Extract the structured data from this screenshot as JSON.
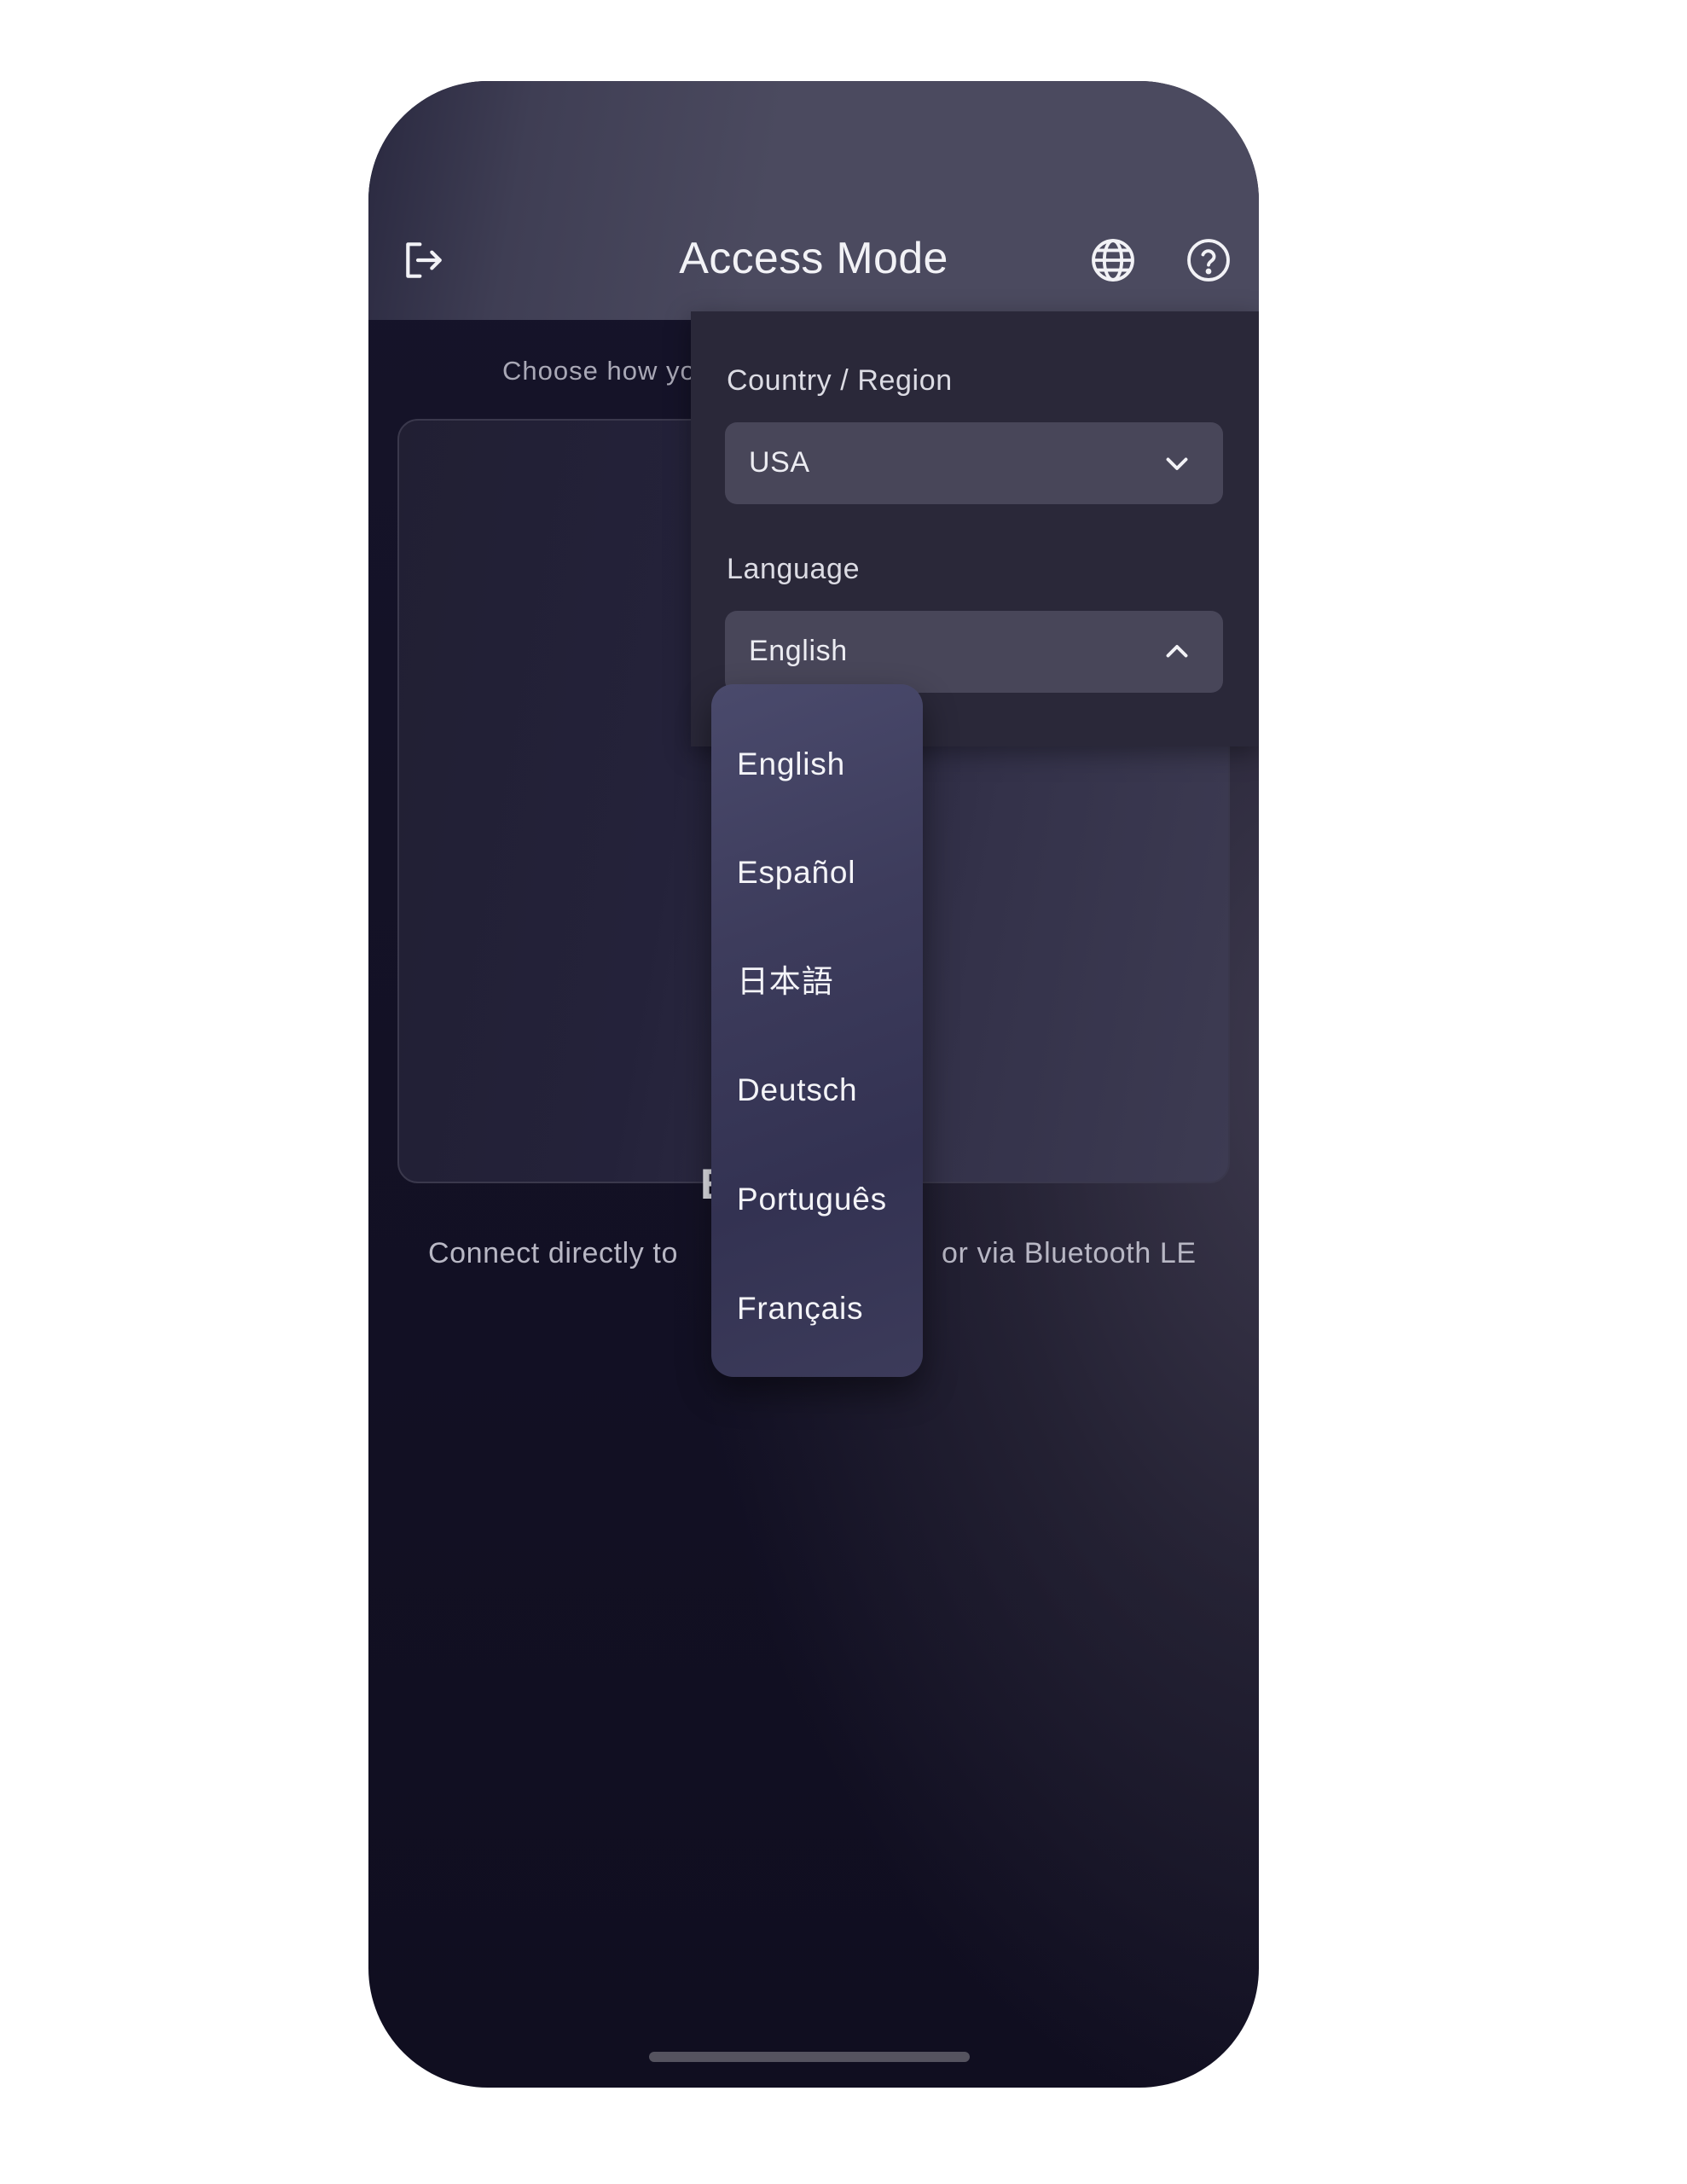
{
  "header": {
    "title": "Access Mode",
    "logout_icon": "logout-icon",
    "globe_icon": "globe-icon",
    "help_icon": "help-icon"
  },
  "subtitle": "Choose how yo",
  "mode_card": {
    "title": "E",
    "description_left": "Connect directly to",
    "description_right": "or via Bluetooth LE"
  },
  "settings_panel": {
    "country_label": "Country / Region",
    "country_value": "USA",
    "language_label": "Language",
    "language_value": "English"
  },
  "language_dropdown": {
    "options": [
      "English",
      "Español",
      "日本語",
      "Deutsch",
      "Português",
      "Français"
    ],
    "selected": "English"
  },
  "colors": {
    "header_bg": "#4b4a5f",
    "panel_bg": "#2a2839",
    "select_bg": "#484659",
    "dropdown_bg": "#3d3c5c",
    "background": "#100e20"
  }
}
